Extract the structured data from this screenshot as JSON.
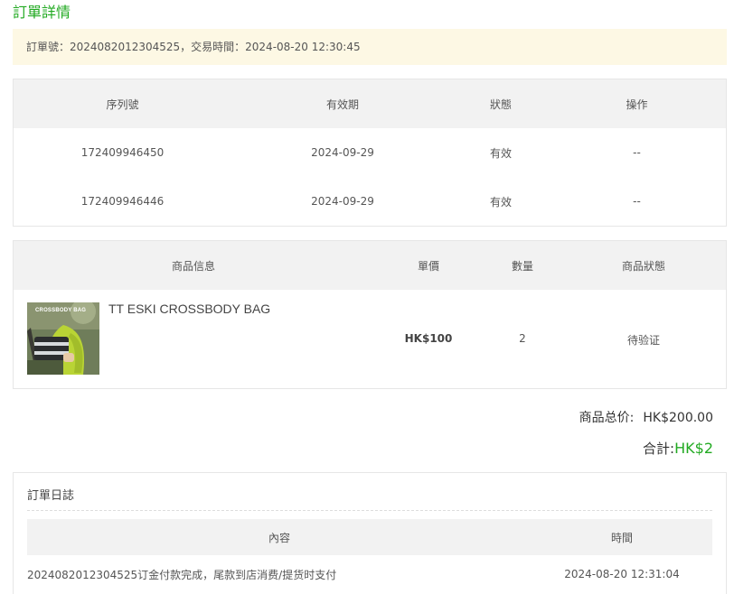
{
  "page": {
    "title": "訂單詳情"
  },
  "order": {
    "summary": "訂單號：2024082012304525，交易時間：2024-08-20 12:30:45"
  },
  "serial_table": {
    "headers": [
      "序列號",
      "有效期",
      "狀態",
      "操作"
    ],
    "rows": [
      {
        "serial": "172409946450",
        "expiry": "2024-09-29",
        "status": "有效",
        "action": "--"
      },
      {
        "serial": "172409946446",
        "expiry": "2024-09-29",
        "status": "有效",
        "action": "--"
      }
    ]
  },
  "product_table": {
    "headers": [
      "商品信息",
      "單價",
      "數量",
      "商品狀態"
    ],
    "item": {
      "image_label": "CROSSBODY BAG",
      "name": "TT ESKI CROSSBODY BAG",
      "price": "HK$100",
      "quantity": "2",
      "status": "待验证"
    }
  },
  "totals": {
    "subtotal_label": "商品总价:",
    "subtotal_value": "HK$200.00",
    "total_label": "合計:",
    "total_value": "HK$2"
  },
  "log": {
    "title": "訂單日誌",
    "headers": [
      "內容",
      "時間"
    ],
    "entries": [
      {
        "content": "2024082012304525订金付款完成，尾款到店消费/提货时支付",
        "time": "2024-08-20 12:31:04"
      }
    ]
  },
  "colors": {
    "accent_green": "#22aa22",
    "banner_bg": "#fdf8e4",
    "header_bg": "#f2f2f2"
  }
}
